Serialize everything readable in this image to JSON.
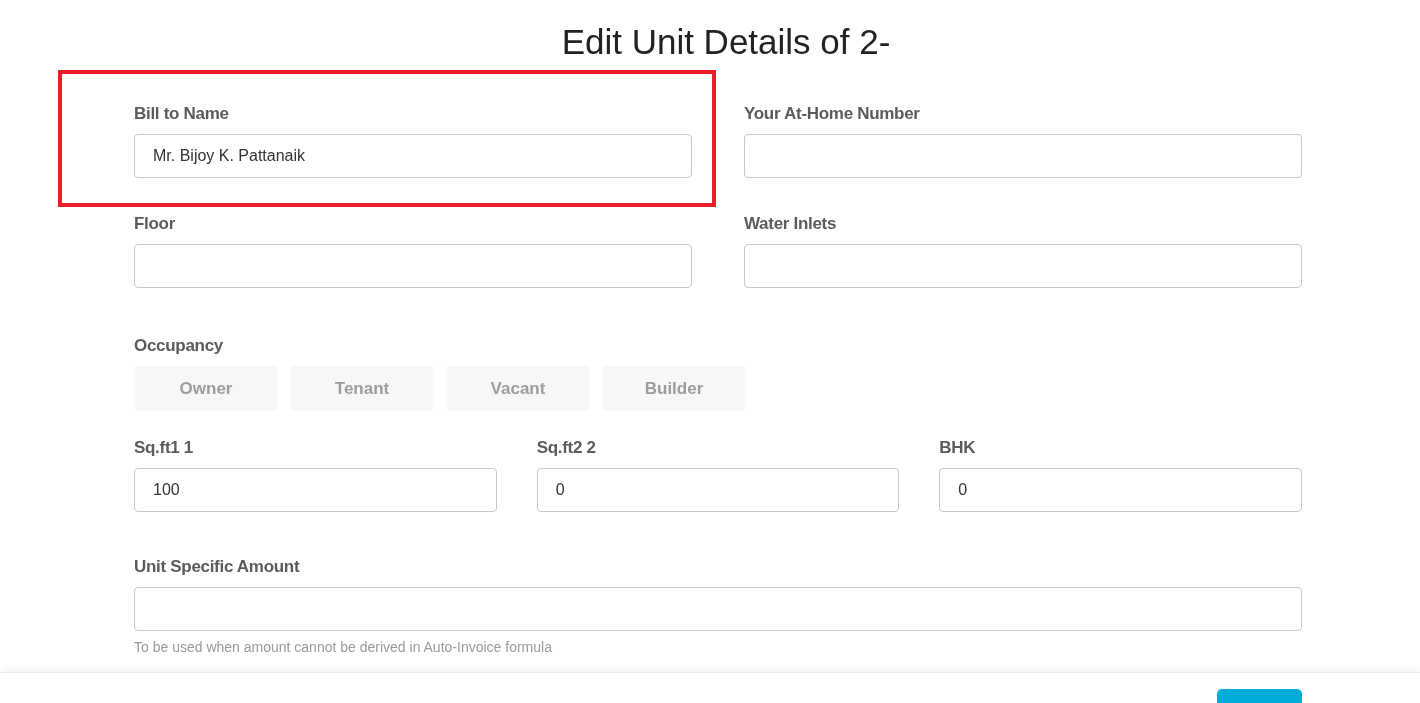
{
  "title": "Edit Unit Details of 2-",
  "top_fields": [
    {
      "label": "Bill to Name",
      "value": "Mr. Bijoy K. Pattanaik",
      "highlighted": true
    },
    {
      "label": "Your At-Home Number",
      "highlighted": false
    },
    {
      "label": "Floor",
      "highlighted": false
    },
    {
      "label": "Water Inlets",
      "highlighted": false
    }
  ],
  "occupancy": {
    "label": "Occupancy",
    "options": [
      {
        "label": "Owner",
        "selected": false
      },
      {
        "label": "Tenant",
        "selected": false
      },
      {
        "label": "Vacant",
        "selected": false
      },
      {
        "label": "Builder",
        "selected": false
      }
    ]
  },
  "size_fields": [
    {
      "label": "Sq.ft1 1",
      "value": "100"
    },
    {
      "label": "Sq.ft2 2",
      "value": "0"
    },
    {
      "label": "BHK",
      "value": "0"
    }
  ],
  "unit_amount": {
    "label": "Unit Specific Amount",
    "hint": "To be used when amount cannot be derived in Auto-Invoice formula"
  }
}
